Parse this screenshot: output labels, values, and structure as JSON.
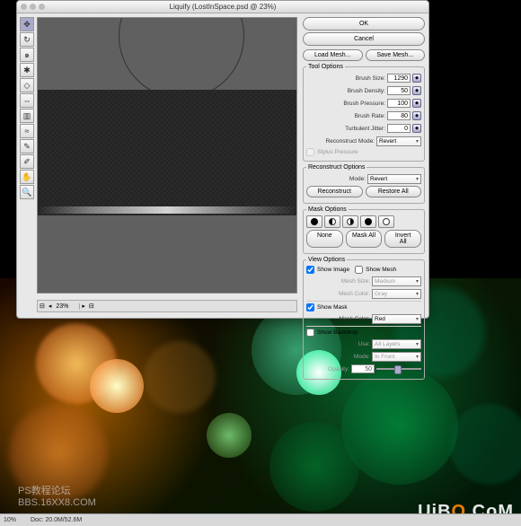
{
  "titlebar": "Liquify (LostInSpace.psd @ 23%)",
  "zoom": "23%",
  "main_buttons": {
    "ok": "OK",
    "cancel": "Cancel"
  },
  "mesh_buttons": {
    "load": "Load Mesh...",
    "save": "Save Mesh..."
  },
  "tool_options": {
    "legend": "Tool Options",
    "brush_size": {
      "label": "Brush Size:",
      "value": "1290"
    },
    "brush_density": {
      "label": "Brush Density:",
      "value": "50"
    },
    "brush_pressure": {
      "label": "Brush Pressure:",
      "value": "100"
    },
    "brush_rate": {
      "label": "Brush Rate:",
      "value": "80"
    },
    "turbulent_jitter": {
      "label": "Turbulent Jitter:",
      "value": "0"
    },
    "reconstruct_mode": {
      "label": "Reconstruct Mode:",
      "value": "Revert"
    },
    "stylus": "Stylus Pressure"
  },
  "reconstruct": {
    "legend": "Reconstruct Options",
    "mode": {
      "label": "Mode:",
      "value": "Revert"
    },
    "btn1": "Reconstruct",
    "btn2": "Restore All"
  },
  "mask": {
    "legend": "Mask Options",
    "none": "None",
    "mask_all": "Mask All",
    "invert_all": "Invert All"
  },
  "view": {
    "legend": "View Options",
    "show_image": "Show Image",
    "show_mesh": "Show Mesh",
    "mesh_size": {
      "label": "Mesh Size:",
      "value": "Medium"
    },
    "mesh_color": {
      "label": "Mesh Color:",
      "value": "Gray"
    },
    "show_mask": "Show Mask",
    "mask_color": {
      "label": "Mask Color:",
      "value": "Red"
    },
    "show_backdrop": "Show Backdrop",
    "use": {
      "label": "Use:",
      "value": "All Layers"
    },
    "mode": {
      "label": "Mode:",
      "value": "In Front"
    },
    "opacity": {
      "label": "Opacity:",
      "value": "50"
    }
  },
  "watermark": {
    "line1": "PS教程论坛",
    "line2": "BBS.16XX8.COM",
    "right": "UiBQ.CoM",
    "docsize": "Doc: 20.0M/52.6M"
  }
}
